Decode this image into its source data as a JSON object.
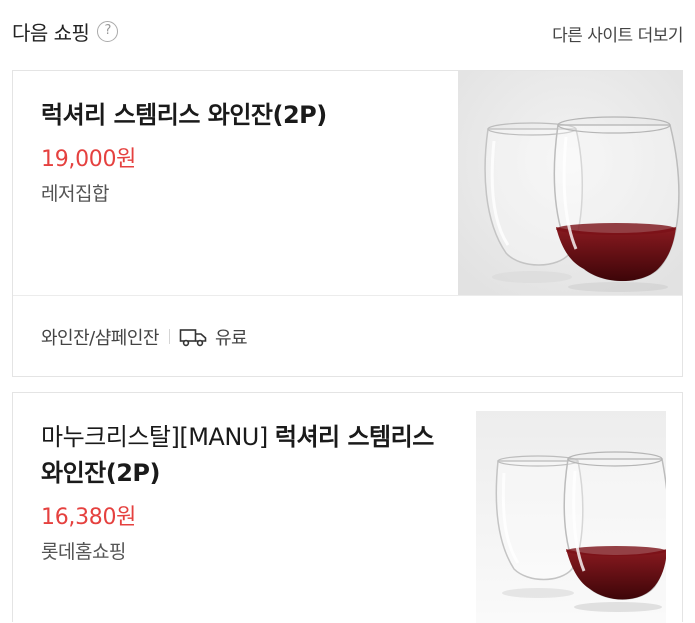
{
  "header": {
    "title": "다음 쇼핑",
    "help_icon": "?",
    "more_link": "다른 사이트 더보기"
  },
  "products": [
    {
      "brand_prefix": "",
      "name": "럭셔리 스템리스 와인잔(2P)",
      "price": "19,000원",
      "seller": "레저집합",
      "category": "와인잔/샴페인잔",
      "shipping": "유료",
      "shipping_icon": "truck-icon",
      "image": "two-stemless-wine-glasses"
    },
    {
      "brand_prefix": "마누크리스탈][MANU]",
      "name": "럭셔리 스템리스 와인잔(2P)",
      "price": "16,380원",
      "seller": "롯데홈쇼핑",
      "image": "two-stemless-wine-glasses"
    }
  ],
  "colors": {
    "price": "#e5413f",
    "wine": "#6b0f14",
    "border": "#e4e4e4"
  }
}
